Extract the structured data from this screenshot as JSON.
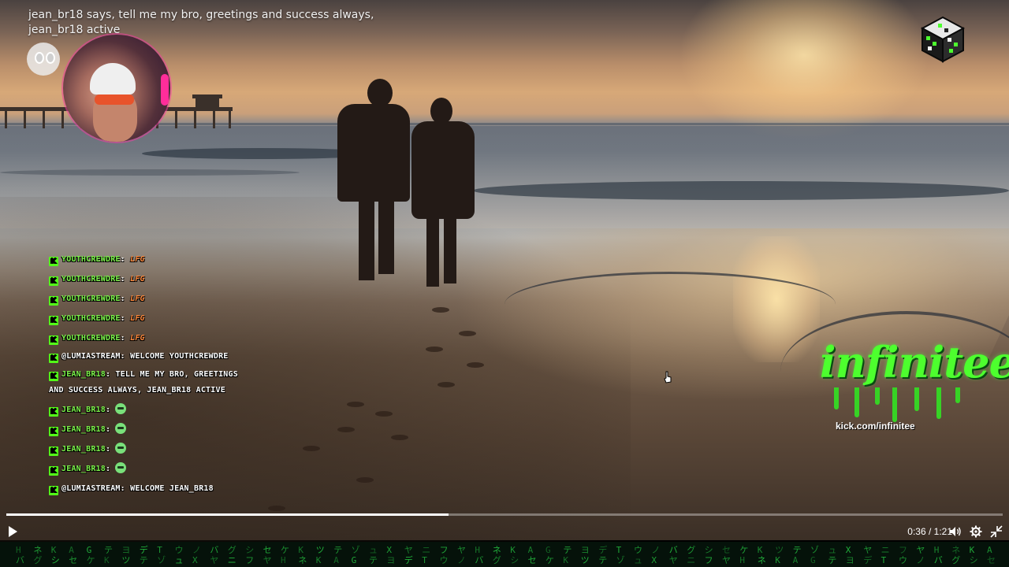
{
  "overlay": {
    "top_message": "jean_br18 says, tell me my bro, greetings and success always, jean_br18 active"
  },
  "chat": {
    "badge_letter": "K",
    "messages": [
      {
        "user": "YOUTHCREWDRE",
        "text": "LFG",
        "kind": "fire"
      },
      {
        "user": "YOUTHCREWDRE",
        "text": "LFG",
        "kind": "fire"
      },
      {
        "user": "YOUTHCREWDRE",
        "text": "LFG",
        "kind": "fire"
      },
      {
        "user": "YOUTHCREWDRE",
        "text": "LFG",
        "kind": "fire"
      },
      {
        "user": "YOUTHCREWDRE",
        "text": "LFG",
        "kind": "fire"
      },
      {
        "user": "@LUMIASTREAM",
        "text": "WELCOME YOUTHCREWDRE",
        "kind": "text"
      },
      {
        "user": "JEAN_BR18",
        "text": "TELL ME MY BRO, GREETINGS AND SUCCESS ALWAYS, JEAN_BR18 ACTIVE",
        "kind": "text"
      },
      {
        "user": "JEAN_BR18",
        "text": "",
        "kind": "emote"
      },
      {
        "user": "JEAN_BR18",
        "text": "",
        "kind": "emote"
      },
      {
        "user": "JEAN_BR18",
        "text": "",
        "kind": "emote"
      },
      {
        "user": "JEAN_BR18",
        "text": "",
        "kind": "emote"
      },
      {
        "user": "@LUMIASTREAM",
        "text": "WELCOME JEAN_BR18",
        "kind": "text"
      }
    ]
  },
  "brand": {
    "name": "infinitee",
    "url": "kick.com/infinitee",
    "color": "#4dff2e"
  },
  "player": {
    "time": "0:36 / 1:21",
    "progress": 0.444,
    "icons": {
      "play": "play-icon",
      "volume": "volume-icon",
      "settings": "gear-icon",
      "exit_fullscreen": "collapse-icon"
    }
  },
  "matrix": {
    "glyphs": [
      "H",
      "ウ",
      "テ",
      "ネ",
      "ノ",
      "ゾ",
      "K",
      "バ",
      "ュ",
      "A",
      "グ",
      "X",
      "G",
      "シ",
      "ヤ",
      "テ",
      "セ",
      "ニ",
      "ヨ",
      "ケ",
      "フ",
      "デ",
      "K",
      "ヤ",
      "T",
      "ツ"
    ]
  },
  "colors": {
    "kick_green": "#53fc18",
    "username_green": "#7cf24a",
    "fire_orange": "#ff8a3d"
  }
}
